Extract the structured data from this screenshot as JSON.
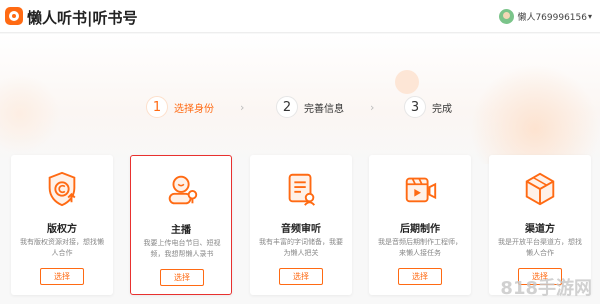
{
  "header": {
    "brand": "懒人听书|听书号",
    "username": "懒人769996156",
    "username_suffix": "▾"
  },
  "steps": [
    {
      "num": "1",
      "label": "选择身份",
      "active": true
    },
    {
      "num": "2",
      "label": "完善信息",
      "active": false
    },
    {
      "num": "3",
      "label": "完成",
      "active": false
    }
  ],
  "step_separator": "›",
  "cards": [
    {
      "title": "版权方",
      "desc": "我有版权资源对接，想找懒人合作",
      "button": "选择",
      "icon": "copyright-upload-icon"
    },
    {
      "title": "主播",
      "desc": "我要上传电台节目、短视频，我想帮懒人录书",
      "button": "选择",
      "icon": "anchor-user-mic-icon"
    },
    {
      "title": "音频审听",
      "desc": "我有丰富的字词储备，我要为懒人把关",
      "button": "选择",
      "icon": "document-review-icon"
    },
    {
      "title": "后期制作",
      "desc": "我是音频后期制作工程师，来懒人接任务",
      "button": "选择",
      "icon": "video-play-icon"
    },
    {
      "title": "渠道方",
      "desc": "我是开放平台渠道方，想找懒人合作",
      "button": "选择",
      "icon": "cube-channel-icon"
    }
  ],
  "watermark": "818手游网",
  "colors": {
    "accent": "#ff6a13",
    "selected_border": "#e8312f"
  }
}
